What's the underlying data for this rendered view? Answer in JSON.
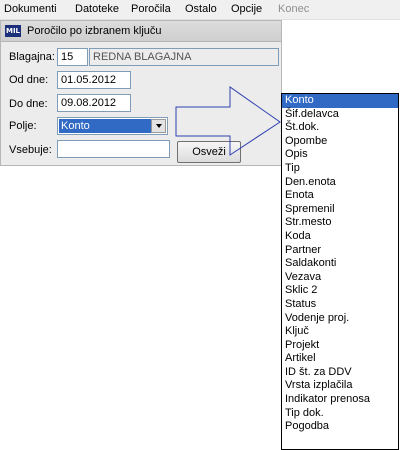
{
  "menu": {
    "items": [
      {
        "label": "Dokumenti",
        "disabled": false
      },
      {
        "label": "Datoteke",
        "disabled": false
      },
      {
        "label": "Poročila",
        "disabled": false
      },
      {
        "label": "Ostalo",
        "disabled": false
      },
      {
        "label": "Opcije",
        "disabled": false
      },
      {
        "label": "Konec",
        "disabled": true
      }
    ]
  },
  "window": {
    "title": "Poročilo po izbranem ključu",
    "logo_text": "MIL"
  },
  "form": {
    "blagajna_label": "Blagajna:",
    "blagajna_code": "15",
    "blagajna_name": "REDNA BLAGAJNA",
    "od_dne_label": "Od dne:",
    "od_dne_value": "01.05.2012",
    "do_dne_label": "Do dne:",
    "do_dne_value": "09.08.2012",
    "polje_label": "Polje:",
    "polje_value": "Konto",
    "vsebuje_label": "Vsebuje:",
    "vsebuje_value": "",
    "osvezi_label": "Osveži"
  },
  "dropdown": {
    "selected_index": 0,
    "options": [
      "Konto",
      "Šif.delavca",
      "Št.dok.",
      "Opombe",
      "Opis",
      "Tip",
      "Den.enota",
      "Enota",
      "Spremenil",
      "Str.mesto",
      "Koda",
      "Partner",
      "Saldakonti",
      "Vezava",
      "Sklic 2",
      "Status",
      "Vodenje proj.",
      "Ključ",
      "Projekt",
      "Artikel",
      "ID št. za DDV",
      "Vrsta izplačila",
      "Indikator prenosa",
      "Tip dok.",
      "Pogodba"
    ]
  },
  "colors": {
    "selection": "#316ac5",
    "arrow_outline": "#2f3fb0",
    "logo_bg": "#1b2f7a"
  }
}
